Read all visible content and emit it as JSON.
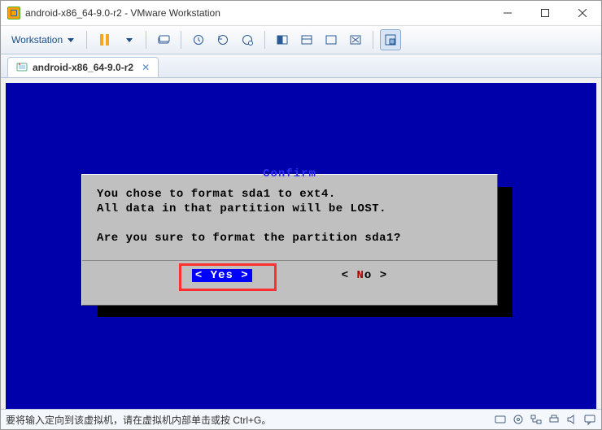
{
  "window": {
    "title": "android-x86_64-9.0-r2 - VMware Workstation"
  },
  "toolbar": {
    "menu_label": "Workstation"
  },
  "tab": {
    "label": "android-x86_64-9.0-r2"
  },
  "dialog": {
    "title": "Confirm",
    "line1": "You chose to format sda1 to ext4.",
    "line2": "All data in that partition will be LOST.",
    "line3": "Are you sure to format the partition sda1?",
    "yes": "< Yes >",
    "no_left": "<  ",
    "no_mid": "N",
    "no_tail": "o  >"
  },
  "status": {
    "message": "要将输入定向到该虚拟机，请在虚拟机内部单击或按 Ctrl+G。"
  }
}
